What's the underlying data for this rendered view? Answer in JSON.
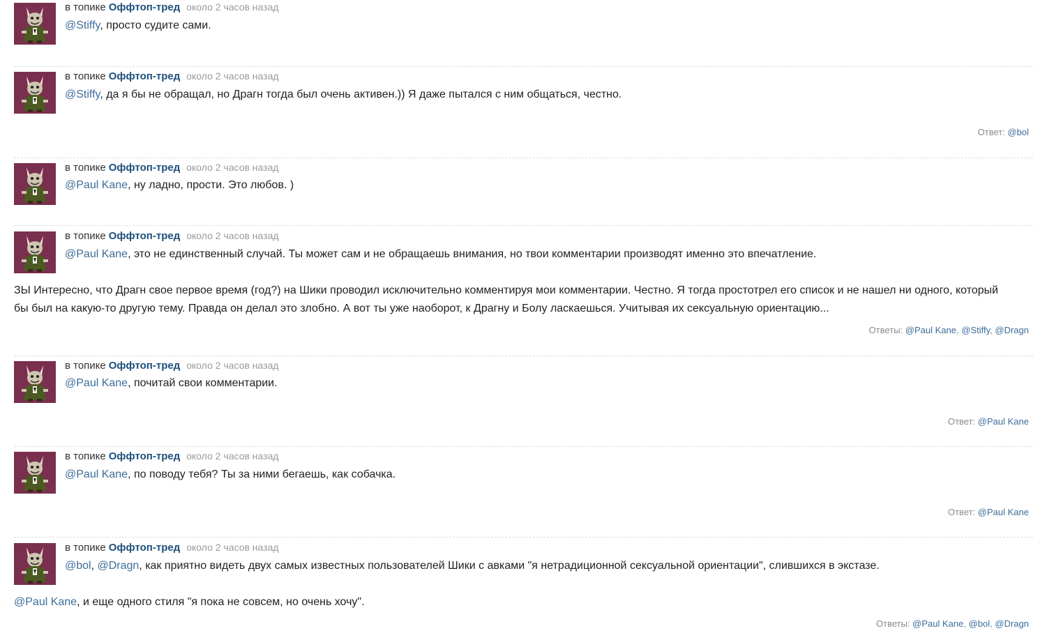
{
  "labels": {
    "in_topic": "в топике",
    "topic": "Оффтоп-тред",
    "time": "около 2 часов назад"
  },
  "colors": {
    "topic_link": "#1d4f7c",
    "mention_link": "#3d6d99",
    "meta_gray": "#9a9a9a",
    "avatar_bg": "#7a2f4e"
  },
  "avatar_icon": "goblin-avatar-icon",
  "comments": [
    {
      "lines": [
        {
          "mentions": [
            "@Stiffy"
          ],
          "text": ", просто судите сами."
        }
      ],
      "reply": null
    },
    {
      "lines": [
        {
          "mentions": [
            "@Stiffy"
          ],
          "text": ", да я бы не обращал, но Драгн тогда был очень активен.)) Я даже пытался с ним общаться, честно."
        }
      ],
      "reply": {
        "label": "Ответ:",
        "users": [
          "@bol"
        ]
      }
    },
    {
      "lines": [
        {
          "mentions": [
            "@Paul Kane"
          ],
          "text": ", ну ладно, прости. Это любов. )"
        }
      ],
      "reply": null
    },
    {
      "lines": [
        {
          "mentions": [
            "@Paul Kane"
          ],
          "text": ", это не единственный случай. Ты может сам и не обращаешь внимания, но твои комментарии производят именно это впечатление."
        },
        {
          "mentions": [],
          "text": "ЗЫ Интересно, что Драгн свое первое время (год?) на Шики проводил исключительно комментируя мои комментарии. Честно. Я тогда простотрел его список и не нашел ни одного, который"
        },
        {
          "mentions": [],
          "text": "бы был на какую-то другую тему. Правда он делал это злобно. А вот ты уже наоборот, к Драгну и Болу ласкаешься. Учитывая их сексуальную ориентацию..."
        }
      ],
      "reply": {
        "label": "Ответы:",
        "users": [
          "@Paul Kane",
          "@Stiffy",
          "@Dragn"
        ]
      }
    },
    {
      "lines": [
        {
          "mentions": [
            "@Paul Kane"
          ],
          "text": ", почитай свои комментарии."
        }
      ],
      "reply": {
        "label": "Ответ:",
        "users": [
          "@Paul Kane"
        ]
      }
    },
    {
      "lines": [
        {
          "mentions": [
            "@Paul Kane"
          ],
          "text": ", по поводу тебя? Ты за ними бегаешь, как собачка."
        }
      ],
      "reply": {
        "label": "Ответ:",
        "users": [
          "@Paul Kane"
        ]
      }
    },
    {
      "lines": [
        {
          "mentions": [
            "@bol",
            "@Dragn"
          ],
          "text": ", как приятно видеть двух самых известных пользователей Шики с авками \"я нетрадиционной сексуальной ориентации\", слившихся в экстазе."
        },
        {
          "mentions": [
            "@Paul Kane"
          ],
          "text": ", и еще одного стиля \"я пока не совсем, но очень хочу\"."
        }
      ],
      "reply": {
        "label": "Ответы:",
        "users": [
          "@Paul Kane",
          "@bol",
          "@Dragn"
        ]
      }
    }
  ]
}
